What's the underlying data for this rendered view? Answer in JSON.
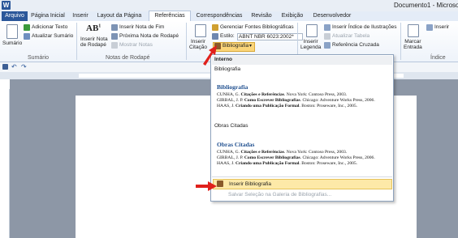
{
  "window": {
    "app_letter": "W",
    "title": "Documento1 - Microso"
  },
  "tabs": [
    "Arquivo",
    "Página Inicial",
    "Inserir",
    "Layout da Página",
    "Referências",
    "Correspondências",
    "Revisão",
    "Exibição",
    "Desenvolvedor"
  ],
  "ribbon": {
    "sumario": {
      "big": "Sumário",
      "add_text": "Adicionar Texto",
      "update": "Atualizar Sumário",
      "group": "Sumário"
    },
    "notes": {
      "insert_note_l1": "Inserir Nota",
      "insert_note_l2": "de Rodapé",
      "ab_label": "AB",
      "ab_sup": "1",
      "end_note": "Inserir Nota de Fim",
      "next_note": "Próxima Nota de Rodapé",
      "show_notes": "Mostrar Notas",
      "group": "Notas de Rodapé"
    },
    "citations": {
      "insert_l1": "Inserir",
      "insert_l2": "Citação",
      "manage": "Gerenciar Fontes Bibliográficas",
      "style_label": "Estilo:",
      "style_value": "ABNT NBR 6023:2002*",
      "bibliography": "Bibliografia"
    },
    "captions": {
      "insert_l1": "Inserir",
      "insert_l2": "Legenda",
      "insert_illus": "Inserir Índice de Ilustrações",
      "update_table": "Atualizar Tabela",
      "cross_ref": "Referência Cruzada"
    },
    "index": {
      "mark_l1": "Marcar",
      "mark_l2": "Entrada",
      "insert": "Inserir",
      "group": "Índice"
    }
  },
  "dropdown": {
    "section_header": "Interno",
    "item1_label": "Bibliografia",
    "item1_title": "Bibliografia",
    "item1_lines": [
      {
        "a": "CUNHA, G. ",
        "b": "Citações e Referências",
        "c": ". Nova York: Contoso Press, 2003."
      },
      {
        "a": "GIRBAL, J. P. ",
        "b": "Como Escrever Bibliografias",
        "c": ". Chicago: Adventure Works Press, 2006."
      },
      {
        "a": "HAAS, J. ",
        "b": "Criando uma Publicação Formal",
        "c": ". Boston: Proseware, Inc., 2005."
      }
    ],
    "item2_label": "Obras Citadas",
    "item2_title": "Obras Citadas",
    "item2_lines": [
      {
        "a": "CUNHA, G. ",
        "b": "Citações e Referências",
        "c": ". Nova York: Contoso Press, 2003."
      },
      {
        "a": "GIRBAL, J. P. ",
        "b": "Como Escrever Bibliografias",
        "c": ". Chicago: Adventure Works Press, 2006."
      },
      {
        "a": "HAAS, J. ",
        "b": "Criando uma Publicação Formal",
        "c": ". Boston: Proseware, Inc., 2005."
      }
    ],
    "insert_bibliography": "Inserir Bibliografia",
    "save_selection": "Salvar Seleção na Galeria de Bibliografias..."
  },
  "colors": {
    "file_tab": "#2b579a",
    "arrow": "#e0201b",
    "highlight": "#fde9a8",
    "bib_title": "#1f4f8f"
  }
}
